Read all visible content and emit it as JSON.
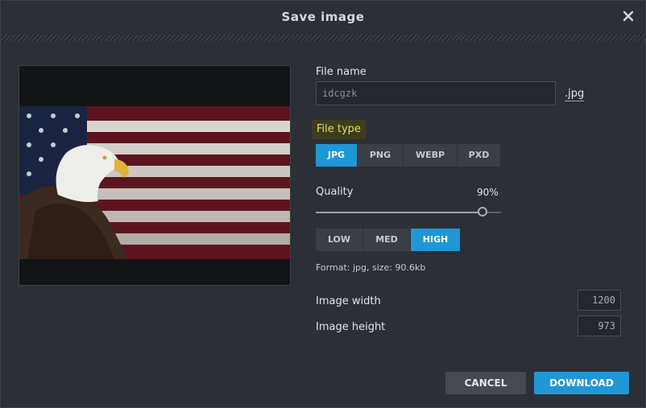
{
  "dialog": {
    "title": "Save image"
  },
  "file_name": {
    "label": "File name",
    "value": "idcgzk",
    "extension": ".jpg"
  },
  "file_type": {
    "label": "File type",
    "options": [
      "JPG",
      "PNG",
      "WEBP",
      "PXD"
    ],
    "selected": "JPG"
  },
  "quality": {
    "label": "Quality",
    "value_text": "90%",
    "level": 0.9,
    "presets": [
      "LOW",
      "MED",
      "HIGH"
    ],
    "selected_preset": "HIGH"
  },
  "format_info": "Format: jpg, size: 90.6kb",
  "image_width": {
    "label": "Image width",
    "value": "1200"
  },
  "image_height": {
    "label": "Image height",
    "value": "973"
  },
  "buttons": {
    "cancel": "CANCEL",
    "download": "DOWNLOAD"
  },
  "icons": {
    "close": "close-icon"
  },
  "colors": {
    "accent": "#1f97d6",
    "highlight": "#e6e05a"
  }
}
